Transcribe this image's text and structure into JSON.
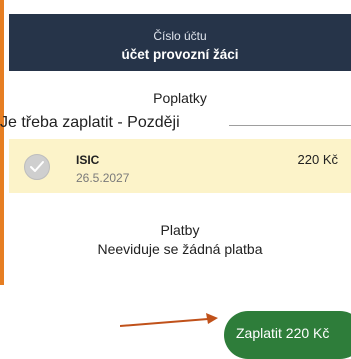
{
  "account": {
    "label": "Číslo účtu",
    "name": "účet provozní žáci"
  },
  "fees": {
    "title": "Poplatky",
    "due_heading": "Je třeba zaplatit - Později",
    "items": [
      {
        "name": "ISIC",
        "due_date": "26.5.2027",
        "amount": "220 Kč",
        "checked": false
      }
    ]
  },
  "payments": {
    "title": "Platby",
    "empty_text": "Neeviduje se žádná platba"
  },
  "pay_button": {
    "label": "Zaplatit 220 Kč"
  },
  "icons": {
    "checkbox": "check-circle-icon",
    "annotation": "arrow-right-icon"
  },
  "colors": {
    "header": "#263449",
    "highlight": "#fcf3c9",
    "button": "#2e7d3a",
    "accent": "#e67e22"
  }
}
